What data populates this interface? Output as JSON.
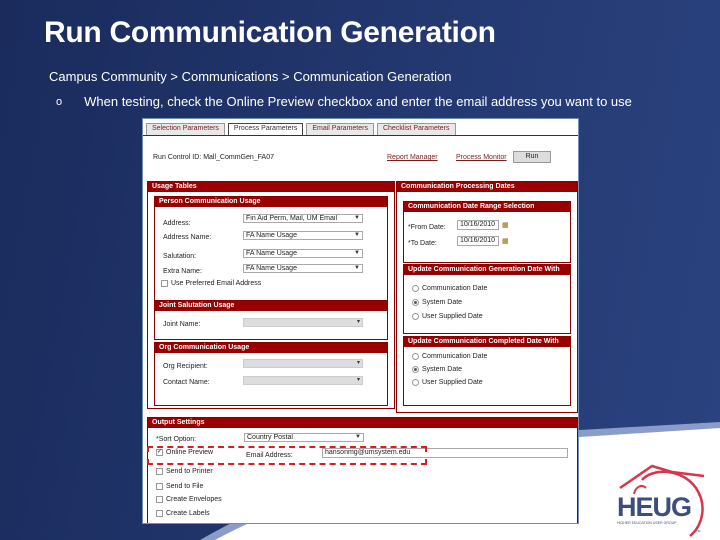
{
  "slide": {
    "title": "Run Communication Generation",
    "breadcrumb": "Campus Community > Communications > Communication Generation",
    "bullet_marker": "o",
    "bullet_text": "When testing, check the Online Preview checkbox and enter the email address you want to use"
  },
  "screenshot": {
    "tabs": [
      {
        "label": "Selection Parameters",
        "active": false
      },
      {
        "label": "Process Parameters",
        "active": true
      },
      {
        "label": "Email Parameters",
        "active": false
      },
      {
        "label": "Checklist Parameters",
        "active": false
      }
    ],
    "run_control_label": "Run Control ID:",
    "run_control_value": "Mall_CommGen_FA07",
    "report_manager": "Report Manager",
    "process_monitor": "Process Monitor",
    "run_button": "Run",
    "usage_tables": {
      "header": "Usage Tables",
      "person": {
        "header": "Person Communication Usage",
        "fields": [
          {
            "label": "Address:",
            "value": "Fin Aid Perm, Mail, UM Email"
          },
          {
            "label": "Address Name:",
            "value": "FA Name Usage"
          },
          {
            "label": "Salutation:",
            "value": "FA Name Usage"
          },
          {
            "label": "Extra Name:",
            "value": "FA Name Usage"
          }
        ],
        "use_preferred_email": {
          "label": "Use Preferred Email Address",
          "checked": false
        }
      },
      "joint": {
        "header": "Joint Salutation Usage",
        "fields": [
          {
            "label": "Joint Name:",
            "value": ""
          }
        ]
      },
      "org": {
        "header": "Org Communication Usage",
        "fields": [
          {
            "label": "Org Recipient:",
            "value": ""
          },
          {
            "label": "Contact Name:",
            "value": ""
          }
        ]
      }
    },
    "processing_dates": {
      "header": "Communication Processing Dates",
      "range": {
        "header": "Communication Date Range Selection",
        "from_label": "*From Date:",
        "from_value": "10/16/2010",
        "to_label": "*To Date:",
        "to_value": "10/16/2010"
      },
      "gen_date": {
        "header": "Update Communication Generation Date With",
        "options": [
          "Communication Date",
          "System Date",
          "User Supplied Date"
        ],
        "selected": "System Date"
      },
      "completed_date": {
        "header": "Update Communication Completed Date With",
        "options": [
          "Communication Date",
          "System Date",
          "User Supplied Date"
        ],
        "selected": "System Date"
      }
    },
    "output": {
      "header": "Output Settings",
      "sort_label": "*Sort Option:",
      "sort_value": "Country Postal",
      "online_preview": {
        "label": "Online Preview",
        "checked": true
      },
      "email_label": "Email Address:",
      "email_value": "hansonmg@umsystem.edu",
      "checkboxes": [
        {
          "label": "Send to Printer",
          "checked": false
        },
        {
          "label": "Send to File",
          "checked": false
        },
        {
          "label": "Create Envelopes",
          "checked": false
        },
        {
          "label": "Create Labels",
          "checked": false
        }
      ]
    }
  },
  "logo": {
    "text": "HEUG",
    "subtitle": "HIGHER EDUCATION USER GROUP",
    "tm": "TM"
  }
}
